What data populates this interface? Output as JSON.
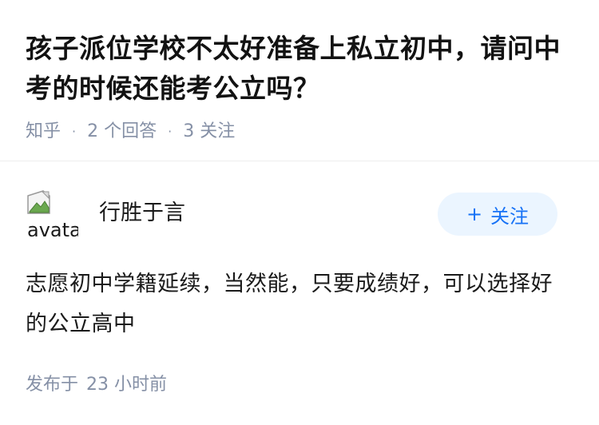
{
  "question": {
    "title": "孩子派位学校不太好准备上私立初中，请问中考的时候还能考公立吗？",
    "meta": {
      "source": "知乎",
      "answer_count": "2",
      "answer_label": "个回答",
      "follow_count": "3",
      "follow_label": "关注"
    }
  },
  "answer": {
    "author": {
      "avatar_alt": "avatar",
      "name": "行胜于言"
    },
    "follow_button": {
      "icon": "plus-icon",
      "plus": "+",
      "label": "关注"
    },
    "content": "志愿初中学籍延续，当然能，只要成绩好，可以选择好的公立高中",
    "published": {
      "label": "发布于",
      "time": "23 小时前"
    }
  },
  "colors": {
    "meta_gray": "#8590a6",
    "follow_blue": "#1772f6",
    "follow_bg": "#ebf5ff",
    "text": "#1a1a1a"
  }
}
